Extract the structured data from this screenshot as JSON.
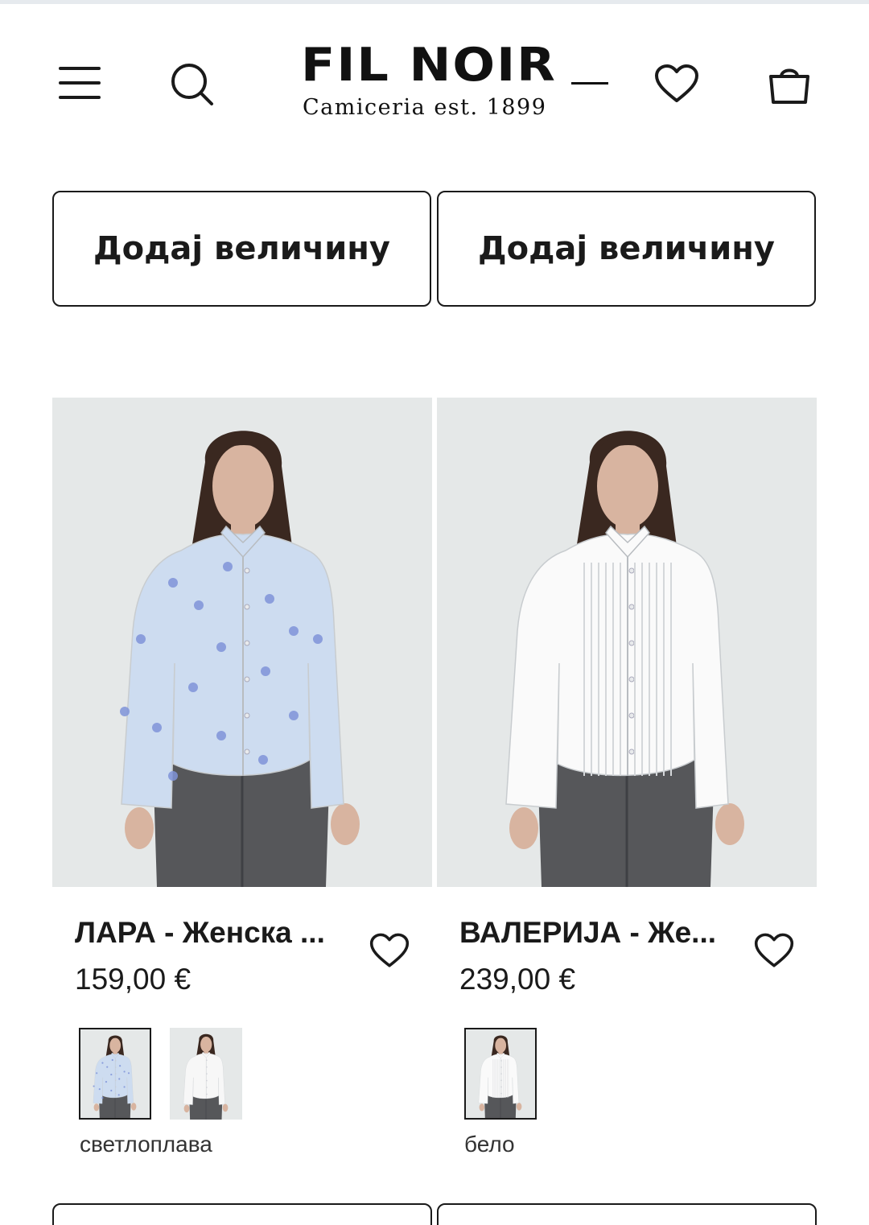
{
  "header": {
    "logo_main": "FIL NOIR",
    "logo_sub": "Camiceria  est. 1899",
    "icons": [
      "hamburger-menu-icon",
      "search-icon",
      "heart-icon",
      "shopping-bag-icon"
    ]
  },
  "size_buttons": [
    {
      "label": "Додај величину"
    },
    {
      "label": "Додај величину"
    }
  ],
  "products": [
    {
      "name": "ЛАРА - Женска ...",
      "price": "159,00 €",
      "shirt_color": "#cddcf0",
      "color_label": "светлоплава",
      "swatches": [
        {
          "shirt_color": "#cddcf0",
          "selected": true
        },
        {
          "shirt_color": "#f7f7f7",
          "selected": false
        }
      ]
    },
    {
      "name": "ВАЛЕРИЈА - Же...",
      "price": "239,00 €",
      "shirt_color": "#fafafa",
      "color_label": "бело",
      "swatches": [
        {
          "shirt_color": "#fafafa",
          "selected": true
        }
      ]
    }
  ],
  "colors": {
    "text": "#1a1a1a",
    "photo_bg": "#e5e8e8",
    "pants": "#56575a",
    "hair": "#3a2820",
    "skin": "#d8b4a0",
    "flower": "#7f93d8"
  }
}
